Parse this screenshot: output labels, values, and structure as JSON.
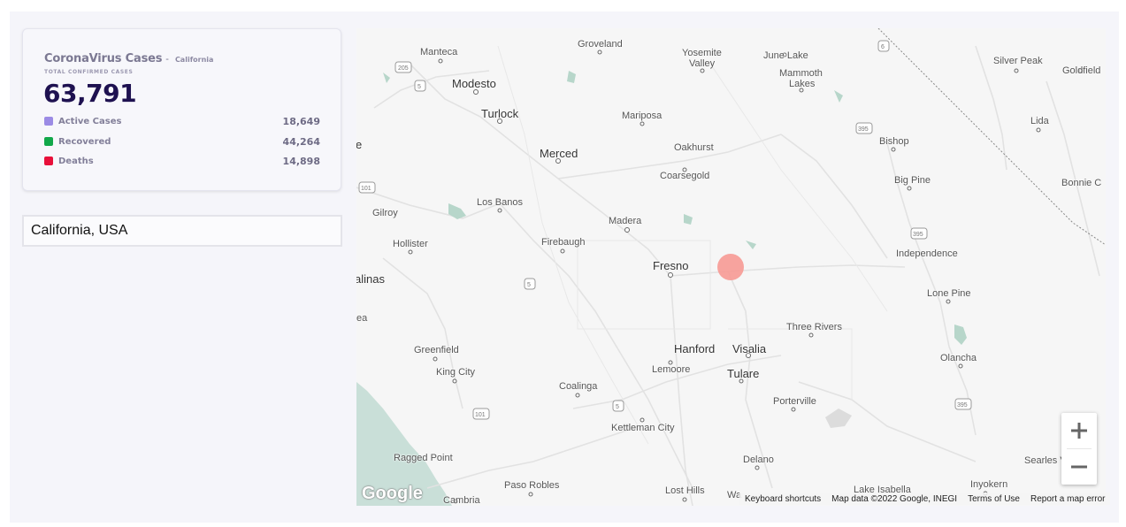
{
  "card": {
    "title": "CoronaVirus Cases",
    "separator": "-",
    "region": "California",
    "subtitle": "TOTAL CONFIRMED CASES",
    "total": "63,791",
    "rows": [
      {
        "label": "Active Cases",
        "value": "18,649",
        "color": "#9b8be5"
      },
      {
        "label": "Recovered",
        "value": "44,264",
        "color": "#12a84a"
      },
      {
        "label": "Deaths",
        "value": "14,898",
        "color": "#e8103a"
      }
    ]
  },
  "search": {
    "value": "California, USA"
  },
  "map": {
    "marker_color": "#f79a95",
    "zoom_in_icon": "plus-icon",
    "zoom_out_icon": "minus-icon",
    "logo": "Google",
    "attribution": {
      "shortcuts": "Keyboard shortcuts",
      "data": "Map data ©2022 Google, INEGI",
      "terms": "Terms of Use",
      "report": "Report a map error"
    },
    "places": [
      {
        "id": "manteca",
        "name": "Manteca",
        "cls": "s"
      },
      {
        "id": "groveland",
        "name": "Groveland",
        "cls": "s"
      },
      {
        "id": "yosemite",
        "name": "Yosemite",
        "cls": "s"
      },
      {
        "id": "yosemite2",
        "name": "Valley",
        "cls": "s"
      },
      {
        "id": "junelake",
        "name": "June Lake",
        "cls": "s"
      },
      {
        "id": "mammoth",
        "name": "Mammoth",
        "cls": "s"
      },
      {
        "id": "mammoth2",
        "name": "Lakes",
        "cls": "s"
      },
      {
        "id": "silverpeak",
        "name": "Silver Peak",
        "cls": "s"
      },
      {
        "id": "goldfield",
        "name": "Goldfield",
        "cls": "s"
      },
      {
        "id": "modesto",
        "name": "Modesto",
        "cls": "m"
      },
      {
        "id": "turlock",
        "name": "Turlock",
        "cls": "m"
      },
      {
        "id": "mariposa",
        "name": "Mariposa",
        "cls": "s"
      },
      {
        "id": "lida",
        "name": "Lida",
        "cls": "s"
      },
      {
        "id": "bishop",
        "name": "Bishop",
        "cls": "s"
      },
      {
        "id": "e",
        "name": "e",
        "cls": "m"
      },
      {
        "id": "merced",
        "name": "Merced",
        "cls": "m"
      },
      {
        "id": "oakhurst",
        "name": "Oakhurst",
        "cls": "s"
      },
      {
        "id": "coarsegold",
        "name": "Coarsegold",
        "cls": "s"
      },
      {
        "id": "bigpine",
        "name": "Big Pine",
        "cls": "s"
      },
      {
        "id": "bonnie",
        "name": "Bonnie C",
        "cls": "s"
      },
      {
        "id": "losbanos",
        "name": "Los Banos",
        "cls": "s"
      },
      {
        "id": "gilroy",
        "name": "Gilroy",
        "cls": "s"
      },
      {
        "id": "madera",
        "name": "Madera",
        "cls": "s"
      },
      {
        "id": "hollister",
        "name": "Hollister",
        "cls": "s"
      },
      {
        "id": "firebaugh",
        "name": "Firebaugh",
        "cls": "s"
      },
      {
        "id": "independence",
        "name": "Independence",
        "cls": "s"
      },
      {
        "id": "fresno",
        "name": "Fresno",
        "cls": "m"
      },
      {
        "id": "salinas",
        "name": "alinas",
        "cls": "m"
      },
      {
        "id": "lonepine",
        "name": "Lone Pine",
        "cls": "s"
      },
      {
        "id": "ea",
        "name": "ea",
        "cls": "s"
      },
      {
        "id": "threerivers",
        "name": "Three Rivers",
        "cls": "s"
      },
      {
        "id": "hanford",
        "name": "Hanford",
        "cls": "m"
      },
      {
        "id": "visalia",
        "name": "Visalia",
        "cls": "m"
      },
      {
        "id": "greenfield",
        "name": "Greenfield",
        "cls": "s"
      },
      {
        "id": "olancha",
        "name": "Olancha",
        "cls": "s"
      },
      {
        "id": "lemoore",
        "name": "Lemoore",
        "cls": "s"
      },
      {
        "id": "tulare",
        "name": "Tulare",
        "cls": "m"
      },
      {
        "id": "kingcity",
        "name": "King City",
        "cls": "s"
      },
      {
        "id": "coalinga",
        "name": "Coalinga",
        "cls": "s"
      },
      {
        "id": "porterville",
        "name": "Porterville",
        "cls": "s"
      },
      {
        "id": "kettleman",
        "name": "Kettleman City",
        "cls": "s"
      },
      {
        "id": "raggedpoint",
        "name": "Ragged Point",
        "cls": "s"
      },
      {
        "id": "delano",
        "name": "Delano",
        "cls": "s"
      },
      {
        "id": "searles",
        "name": "Searles V",
        "cls": "s"
      },
      {
        "id": "pasorobles",
        "name": "Paso Robles",
        "cls": "s"
      },
      {
        "id": "losthills",
        "name": "Lost Hills",
        "cls": "s"
      },
      {
        "id": "lakeisabella",
        "name": "Lake Isabella",
        "cls": "s"
      },
      {
        "id": "inyokern",
        "name": "Inyokern",
        "cls": "s"
      },
      {
        "id": "cambria",
        "name": "Cambria",
        "cls": "s"
      },
      {
        "id": "wa",
        "name": "Wa",
        "cls": "s"
      }
    ]
  }
}
